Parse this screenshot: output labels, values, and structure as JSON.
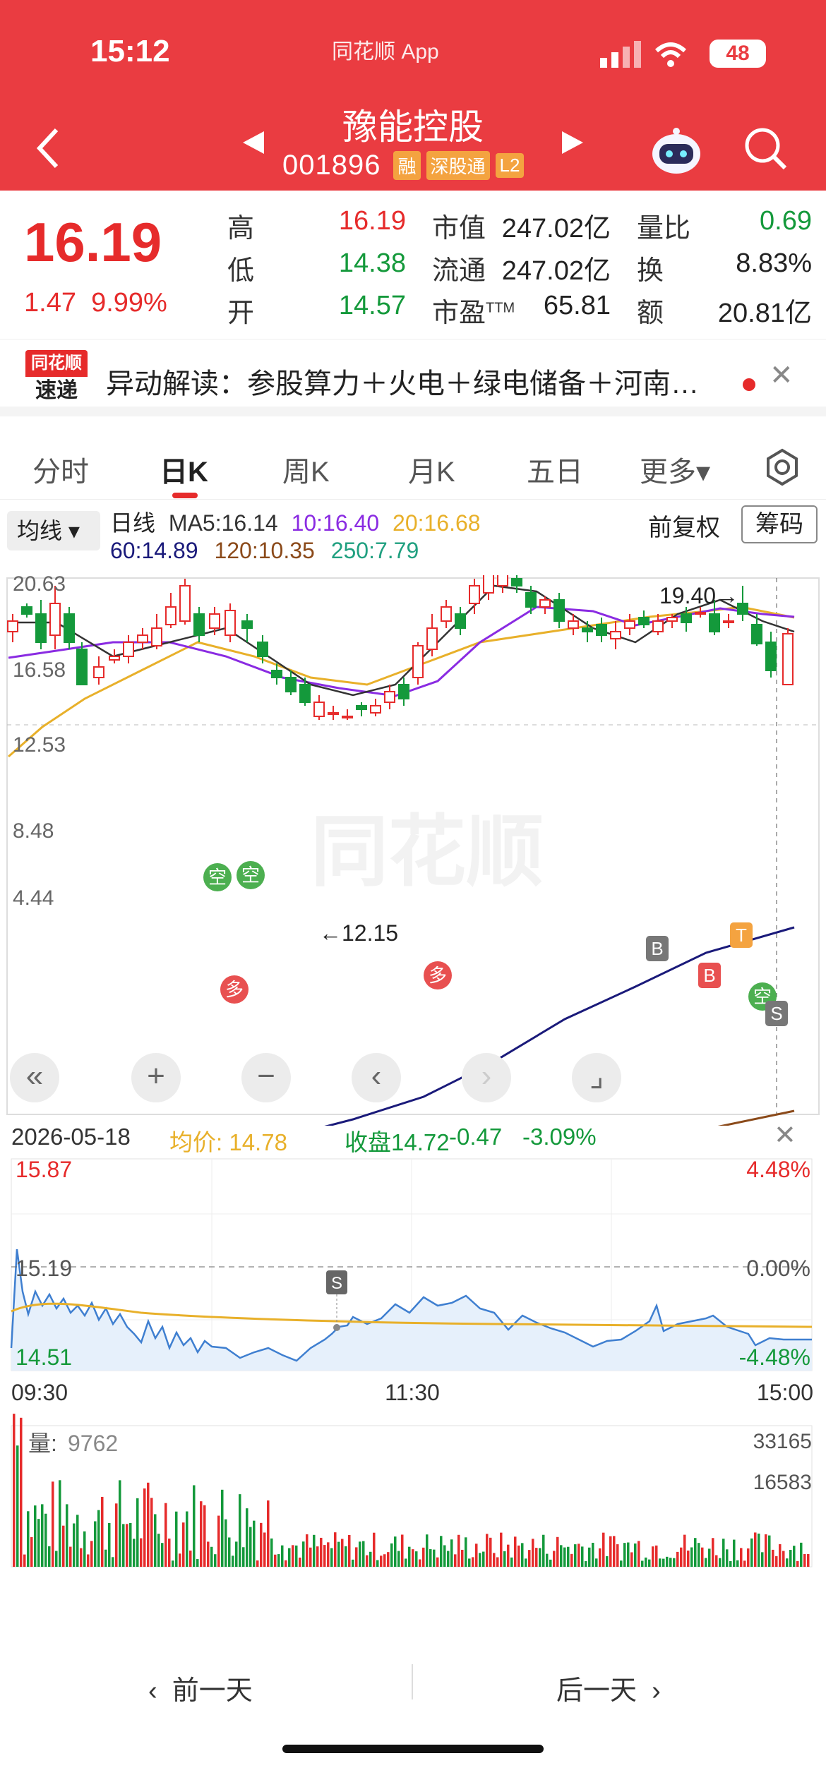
{
  "status": {
    "time": "15:12",
    "app_label": "同花顺 App",
    "battery": "48"
  },
  "header": {
    "name": "豫能控股",
    "code": "001896",
    "tags": [
      "融",
      "深股通",
      "L2"
    ]
  },
  "quote": {
    "price": "16.19",
    "change": "1.47",
    "change_pct": "9.99%",
    "rows": [
      {
        "l1": "高",
        "v1": "16.19",
        "c1": "red",
        "l2": "市值",
        "v2": "247.02亿",
        "l3": "量比",
        "v3": "0.69",
        "c3": "green"
      },
      {
        "l1": "低",
        "v1": "14.38",
        "c1": "green",
        "l2": "流通",
        "v2": "247.02亿",
        "l3": "换",
        "v3": "8.83%",
        "c3": "dark"
      },
      {
        "l1": "开",
        "v1": "14.57",
        "c1": "green",
        "l2": "市盈TTM",
        "v2": "65.81",
        "l3": "额",
        "v3": "20.81亿",
        "c3": "dark"
      }
    ]
  },
  "news": {
    "logo_top": "同花顺",
    "logo_bottom": "速递",
    "text": "异动解读：参股算力＋火电＋绿电储备＋河南…"
  },
  "tabs": [
    "分时",
    "日K",
    "周K",
    "月K",
    "五日",
    "更多▾"
  ],
  "active_tab": 1,
  "legend": {
    "ma_button": "均线",
    "line1_prefix": "日线",
    "ma5": "MA5:16.14",
    "ma10": "10:16.40",
    "ma20": "20:16.68",
    "ma60": "60:14.89",
    "ma120": "120:10.35",
    "ma250": "250:7.79",
    "fq": "前复权",
    "chip": "筹码",
    "colors": {
      "ma5": "#333333",
      "ma10": "#8a2be2",
      "ma20": "#e8b02a",
      "ma60": "#1a1a7a",
      "ma120": "#8b4a1a",
      "ma250": "#20a080"
    }
  },
  "kline": {
    "y_labels": [
      "20.63",
      "16.58",
      "12.53",
      "8.48",
      "4.44"
    ],
    "high_label": "19.40→",
    "low_label": "←12.15",
    "watermark": "同花顺",
    "signals": {
      "kong": "空",
      "duo": "多",
      "b": "B",
      "s": "S",
      "t": "T"
    }
  },
  "controls": [
    "«",
    "+",
    "−",
    "‹",
    "›",
    "⌟"
  ],
  "intraday": {
    "date": "2026-05-18",
    "avg_label": "均价:",
    "avg_value": "14.78",
    "close_label": "收盘",
    "close_value": "14.72",
    "chg": "-0.47",
    "chg_pct": "-3.09%",
    "y_top": "15.87",
    "y_mid": "15.19",
    "y_bot": "14.51",
    "pct_top": "4.48%",
    "pct_mid": "0.00%",
    "pct_bot": "-4.48%",
    "t_start": "09:30",
    "t_mid": "11:30",
    "t_end": "15:00",
    "vol_label": "量:",
    "vol_value": "9762",
    "vol_max": "33165",
    "vol_mid": "16583",
    "s_marker": "S"
  },
  "day_nav": {
    "prev": "前一天",
    "next": "后一天"
  }
}
